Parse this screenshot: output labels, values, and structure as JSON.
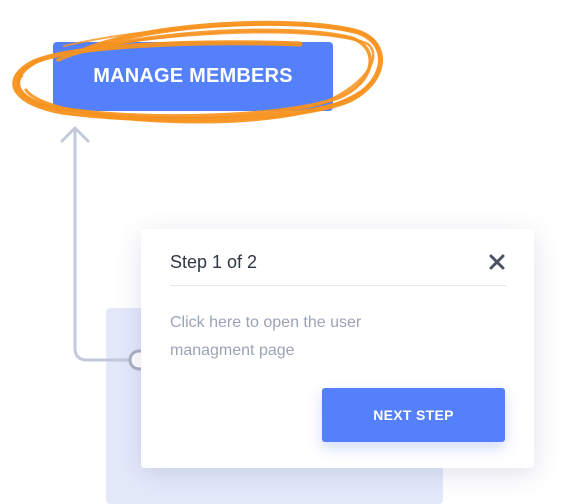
{
  "manage_button": {
    "label": "MANAGE MEMBERS"
  },
  "popover": {
    "step_title": "Step 1 of 2",
    "description_line1": "Click here to open the user",
    "description_line2": "managment page",
    "next_button": "NEXT STEP",
    "close_icon": "close-icon"
  },
  "colors": {
    "accent": "#5580fb",
    "highlight": "#f7921e",
    "connector": "#c3c9da",
    "backdrop": "#e4e9fa"
  }
}
